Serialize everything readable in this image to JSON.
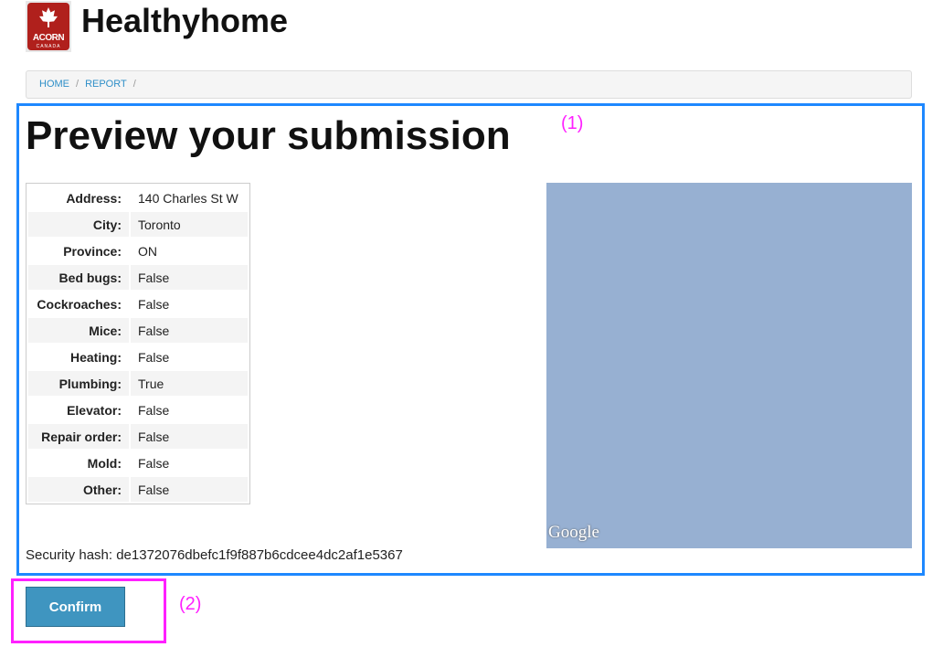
{
  "header": {
    "logo_text": "ACORN CANADA",
    "brand": "Healthyhome"
  },
  "breadcrumb": {
    "items": [
      "HOME",
      "REPORT"
    ]
  },
  "main": {
    "title": "Preview your submission",
    "fields": [
      {
        "label": "Address:",
        "value": "140 Charles St W"
      },
      {
        "label": "City:",
        "value": "Toronto"
      },
      {
        "label": "Province:",
        "value": "ON"
      },
      {
        "label": "Bed bugs:",
        "value": "False"
      },
      {
        "label": "Cockroaches:",
        "value": "False"
      },
      {
        "label": "Mice:",
        "value": "False"
      },
      {
        "label": "Heating:",
        "value": "False"
      },
      {
        "label": "Plumbing:",
        "value": "True"
      },
      {
        "label": "Elevator:",
        "value": "False"
      },
      {
        "label": "Repair order:",
        "value": "False"
      },
      {
        "label": "Mold:",
        "value": "False"
      },
      {
        "label": "Other:",
        "value": "False"
      }
    ],
    "map_attribution": "Google",
    "security_hash": "Security hash: de1372076dbefc1f9f887b6cdcee4dc2af1e5367",
    "confirm_label": "Confirm"
  },
  "annotations": {
    "region1": "(1)",
    "region2": "(2)"
  }
}
